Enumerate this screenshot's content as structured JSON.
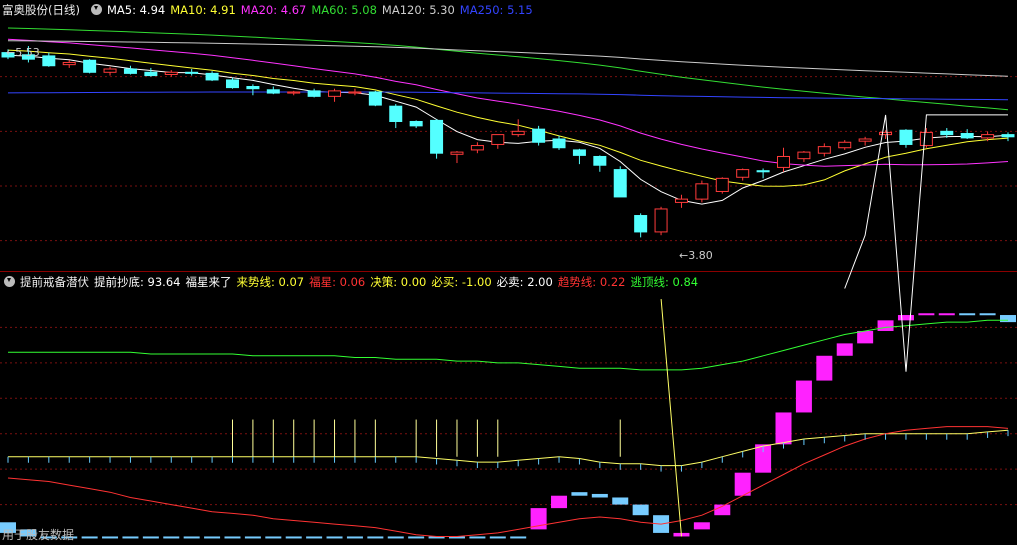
{
  "top": {
    "title": "富奥股份(日线)",
    "ma": [
      {
        "label": "MA5:",
        "value": "4.94",
        "color": "#ffffff"
      },
      {
        "label": "MA10:",
        "value": "4.91",
        "color": "#ffff33"
      },
      {
        "label": "MA20:",
        "value": "4.67",
        "color": "#ff33ff"
      },
      {
        "label": "MA60:",
        "value": "5.08",
        "color": "#33dd33"
      },
      {
        "label": "MA120:",
        "value": "5.30",
        "color": "#cccccc"
      },
      {
        "label": "MA250:",
        "value": "5.15",
        "color": "#3344ff"
      }
    ],
    "high_label": "5.53",
    "low_label": "3.80"
  },
  "bottom": {
    "title": "提前戒备潜伏",
    "items": [
      {
        "label": "提前抄底:",
        "value": "93.64",
        "color": "#ffffff"
      },
      {
        "label": "福星来了",
        "value": "",
        "color": "#ffffff"
      },
      {
        "label": "来势线:",
        "value": "0.07",
        "color": "#ffff33"
      },
      {
        "label": "福星:",
        "value": "0.06",
        "color": "#ff3333"
      },
      {
        "label": "决策:",
        "value": "0.00",
        "color": "#ffff33"
      },
      {
        "label": "必买:",
        "value": "-1.00",
        "color": "#ffff33"
      },
      {
        "label": "必卖:",
        "value": "2.00",
        "color": "#ffffff"
      },
      {
        "label": "趋势线:",
        "value": "0.22",
        "color": "#ff3333"
      },
      {
        "label": "逃顶线:",
        "value": "0.84",
        "color": "#33ff33"
      }
    ],
    "watermark": "用于股友数据"
  },
  "chart_data": [
    {
      "type": "candlestick",
      "x_index": [
        0,
        1,
        2,
        3,
        4,
        5,
        6,
        7,
        8,
        9,
        10,
        11,
        12,
        13,
        14,
        15,
        16,
        17,
        18,
        19,
        20,
        21,
        22,
        23,
        24,
        25,
        26,
        27,
        28,
        29,
        30,
        31,
        32,
        33,
        34,
        35,
        36,
        37,
        38,
        39,
        40,
        41,
        42,
        43,
        44,
        45,
        46,
        47,
        48,
        49
      ],
      "ohlc": [
        [
          5.47,
          5.5,
          5.41,
          5.43
        ],
        [
          5.45,
          5.53,
          5.38,
          5.41
        ],
        [
          5.44,
          5.47,
          5.34,
          5.35
        ],
        [
          5.36,
          5.4,
          5.33,
          5.38
        ],
        [
          5.4,
          5.41,
          5.28,
          5.29
        ],
        [
          5.29,
          5.34,
          5.26,
          5.32
        ],
        [
          5.32,
          5.35,
          5.27,
          5.28
        ],
        [
          5.29,
          5.33,
          5.25,
          5.26
        ],
        [
          5.27,
          5.31,
          5.25,
          5.29
        ],
        [
          5.29,
          5.32,
          5.26,
          5.28
        ],
        [
          5.28,
          5.3,
          5.21,
          5.22
        ],
        [
          5.22,
          5.24,
          5.14,
          5.15
        ],
        [
          5.16,
          5.18,
          5.08,
          5.14
        ],
        [
          5.13,
          5.16,
          5.09,
          5.1
        ],
        [
          5.1,
          5.12,
          5.08,
          5.11
        ],
        [
          5.12,
          5.14,
          5.06,
          5.07
        ],
        [
          5.07,
          5.14,
          5.02,
          5.12
        ],
        [
          5.1,
          5.14,
          5.08,
          5.11
        ],
        [
          5.11,
          5.12,
          4.98,
          4.99
        ],
        [
          4.98,
          5.0,
          4.78,
          4.84
        ],
        [
          4.84,
          4.85,
          4.78,
          4.8
        ],
        [
          4.85,
          4.86,
          4.5,
          4.55
        ],
        [
          4.54,
          4.57,
          4.46,
          4.56
        ],
        [
          4.58,
          4.65,
          4.55,
          4.62
        ],
        [
          4.63,
          4.72,
          4.59,
          4.72
        ],
        [
          4.72,
          4.86,
          4.7,
          4.75
        ],
        [
          4.77,
          4.8,
          4.62,
          4.65
        ],
        [
          4.68,
          4.71,
          4.58,
          4.6
        ],
        [
          4.58,
          4.59,
          4.45,
          4.53
        ],
        [
          4.52,
          4.53,
          4.38,
          4.44
        ],
        [
          4.4,
          4.43,
          4.15,
          4.15
        ],
        [
          3.98,
          4.0,
          3.78,
          3.83
        ],
        [
          3.83,
          4.06,
          3.8,
          4.04
        ],
        [
          4.1,
          4.17,
          4.05,
          4.13
        ],
        [
          4.13,
          4.3,
          4.1,
          4.27
        ],
        [
          4.2,
          4.33,
          4.18,
          4.32
        ],
        [
          4.33,
          4.41,
          4.3,
          4.4
        ],
        [
          4.39,
          4.41,
          4.32,
          4.38
        ],
        [
          4.42,
          4.6,
          4.38,
          4.52
        ],
        [
          4.5,
          4.57,
          4.47,
          4.56
        ],
        [
          4.55,
          4.64,
          4.52,
          4.61
        ],
        [
          4.6,
          4.67,
          4.58,
          4.65
        ],
        [
          4.66,
          4.7,
          4.62,
          4.68
        ],
        [
          4.72,
          4.76,
          4.68,
          4.74
        ],
        [
          4.76,
          4.77,
          4.6,
          4.63
        ],
        [
          4.62,
          4.78,
          4.6,
          4.74
        ],
        [
          4.75,
          4.78,
          4.69,
          4.72
        ],
        [
          4.73,
          4.77,
          4.68,
          4.69
        ],
        [
          4.69,
          4.75,
          4.66,
          4.72
        ],
        [
          4.72,
          4.74,
          4.66,
          4.7
        ]
      ],
      "ylim": [
        3.5,
        5.75
      ]
    },
    {
      "type": "line",
      "series": [
        {
          "name": "来势线",
          "color": "#ffff66",
          "style": "line",
          "values": [
            0.07,
            0.07,
            0.07,
            0.07,
            0.07,
            0.07,
            0.07,
            0.07,
            0.07,
            0.07,
            0.07,
            0.07,
            0.07,
            0.07,
            0.07,
            0.07,
            0.07,
            0.07,
            0.07,
            0.07,
            0.07,
            0.06,
            0.05,
            0.04,
            0.04,
            0.05,
            0.06,
            0.07,
            0.06,
            0.04,
            0.03,
            0.03,
            0.02,
            0.02,
            0.04,
            0.07,
            0.1,
            0.13,
            0.15,
            0.17,
            0.18,
            0.19,
            0.2,
            0.2,
            0.2,
            0.2,
            0.2,
            0.2,
            0.21,
            0.22
          ]
        },
        {
          "name": "福星",
          "color": "#ff3333",
          "style": "line",
          "values": [
            -0.05,
            -0.06,
            -0.07,
            -0.09,
            -0.11,
            -0.13,
            -0.16,
            -0.18,
            -0.2,
            -0.22,
            -0.24,
            -0.25,
            -0.26,
            -0.28,
            -0.29,
            -0.3,
            -0.31,
            -0.32,
            -0.33,
            -0.35,
            -0.37,
            -0.38,
            -0.38,
            -0.37,
            -0.36,
            -0.34,
            -0.32,
            -0.3,
            -0.28,
            -0.27,
            -0.28,
            -0.3,
            -0.31,
            -0.29,
            -0.26,
            -0.21,
            -0.15,
            -0.09,
            -0.03,
            0.03,
            0.08,
            0.13,
            0.17,
            0.2,
            0.22,
            0.23,
            0.24,
            0.24,
            0.24,
            0.23
          ]
        },
        {
          "name": "逃顶线",
          "color": "#33ff33",
          "style": "line",
          "values": [
            0.66,
            0.66,
            0.66,
            0.66,
            0.66,
            0.66,
            0.66,
            0.65,
            0.65,
            0.65,
            0.65,
            0.65,
            0.64,
            0.64,
            0.64,
            0.64,
            0.64,
            0.63,
            0.63,
            0.62,
            0.62,
            0.62,
            0.61,
            0.61,
            0.6,
            0.6,
            0.59,
            0.58,
            0.57,
            0.57,
            0.57,
            0.56,
            0.56,
            0.56,
            0.57,
            0.59,
            0.61,
            0.64,
            0.67,
            0.7,
            0.73,
            0.76,
            0.78,
            0.8,
            0.81,
            0.82,
            0.83,
            0.83,
            0.84,
            0.84
          ]
        },
        {
          "name": "必卖",
          "color": "#ffffff",
          "style": "line",
          "values": [
            null,
            null,
            null,
            null,
            null,
            null,
            null,
            null,
            null,
            null,
            null,
            null,
            null,
            null,
            null,
            null,
            null,
            null,
            null,
            null,
            null,
            null,
            null,
            null,
            null,
            null,
            null,
            null,
            null,
            null,
            null,
            null,
            null,
            null,
            null,
            null,
            null,
            null,
            null,
            null,
            null,
            1.02,
            1.32,
            2.0,
            0.55,
            2.0,
            2.0,
            2.0,
            2.0,
            2.0
          ]
        },
        {
          "name": "提前抄底",
          "color": "#ffff99",
          "style": "spikes",
          "values": [
            0,
            0,
            0,
            0,
            0,
            0,
            0,
            0,
            0,
            0,
            0,
            0.28,
            0.28,
            0.28,
            0.28,
            0.28,
            0.28,
            0.28,
            0.28,
            0,
            0.28,
            0.28,
            0.28,
            0.28,
            0.28,
            0,
            0,
            0,
            0,
            0,
            0.28,
            0,
            0,
            0,
            0,
            0,
            0,
            0,
            0,
            0,
            0,
            0,
            0,
            0,
            0,
            0,
            0,
            0,
            0,
            0
          ]
        },
        {
          "name": "决策",
          "color": "#ffff66",
          "style": "line",
          "values": [
            null,
            null,
            null,
            null,
            null,
            null,
            null,
            null,
            null,
            null,
            null,
            null,
            null,
            null,
            null,
            null,
            null,
            null,
            null,
            null,
            null,
            null,
            null,
            null,
            null,
            null,
            null,
            null,
            null,
            null,
            null,
            null,
            0.96,
            -0.38,
            null,
            null,
            null,
            null,
            null,
            null,
            null,
            null,
            null,
            null,
            null,
            null,
            null,
            null,
            null,
            null
          ]
        }
      ],
      "bars": {
        "low": [
          -0.36,
          -0.38,
          -0.38,
          -0.38,
          -0.38,
          -0.38,
          -0.38,
          -0.38,
          -0.38,
          -0.38,
          -0.38,
          -0.38,
          -0.38,
          -0.38,
          -0.38,
          -0.38,
          -0.38,
          -0.38,
          -0.38,
          -0.38,
          -0.38,
          -0.38,
          -0.38,
          -0.38,
          -0.38,
          -0.38,
          -0.34,
          -0.22,
          -0.15,
          -0.16,
          -0.2,
          -0.26,
          -0.36,
          -0.38,
          -0.34,
          -0.26,
          -0.15,
          -0.02,
          0.14,
          0.32,
          0.5,
          0.64,
          0.71,
          0.78,
          0.84,
          0.87,
          0.88,
          0.88,
          0.87,
          0.83
        ],
        "high": [
          -0.3,
          -0.34,
          -0.38,
          -0.38,
          -0.38,
          -0.38,
          -0.38,
          -0.38,
          -0.38,
          -0.38,
          -0.38,
          -0.38,
          -0.38,
          -0.38,
          -0.38,
          -0.38,
          -0.38,
          -0.38,
          -0.38,
          -0.38,
          -0.38,
          -0.38,
          -0.38,
          -0.38,
          -0.38,
          -0.38,
          -0.22,
          -0.15,
          -0.13,
          -0.14,
          -0.16,
          -0.2,
          -0.26,
          -0.36,
          -0.3,
          -0.2,
          -0.02,
          0.14,
          0.32,
          0.5,
          0.64,
          0.71,
          0.78,
          0.84,
          0.87,
          0.88,
          0.88,
          0.88,
          0.88,
          0.87
        ],
        "up": [
          false,
          false,
          false,
          false,
          false,
          false,
          false,
          false,
          false,
          false,
          false,
          false,
          false,
          false,
          false,
          false,
          false,
          false,
          false,
          false,
          false,
          false,
          false,
          false,
          false,
          false,
          true,
          true,
          false,
          false,
          false,
          false,
          false,
          true,
          true,
          true,
          true,
          true,
          true,
          true,
          true,
          true,
          true,
          true,
          true,
          true,
          true,
          false,
          false,
          false
        ]
      },
      "ylim": [
        -0.4,
        1.0
      ]
    }
  ]
}
